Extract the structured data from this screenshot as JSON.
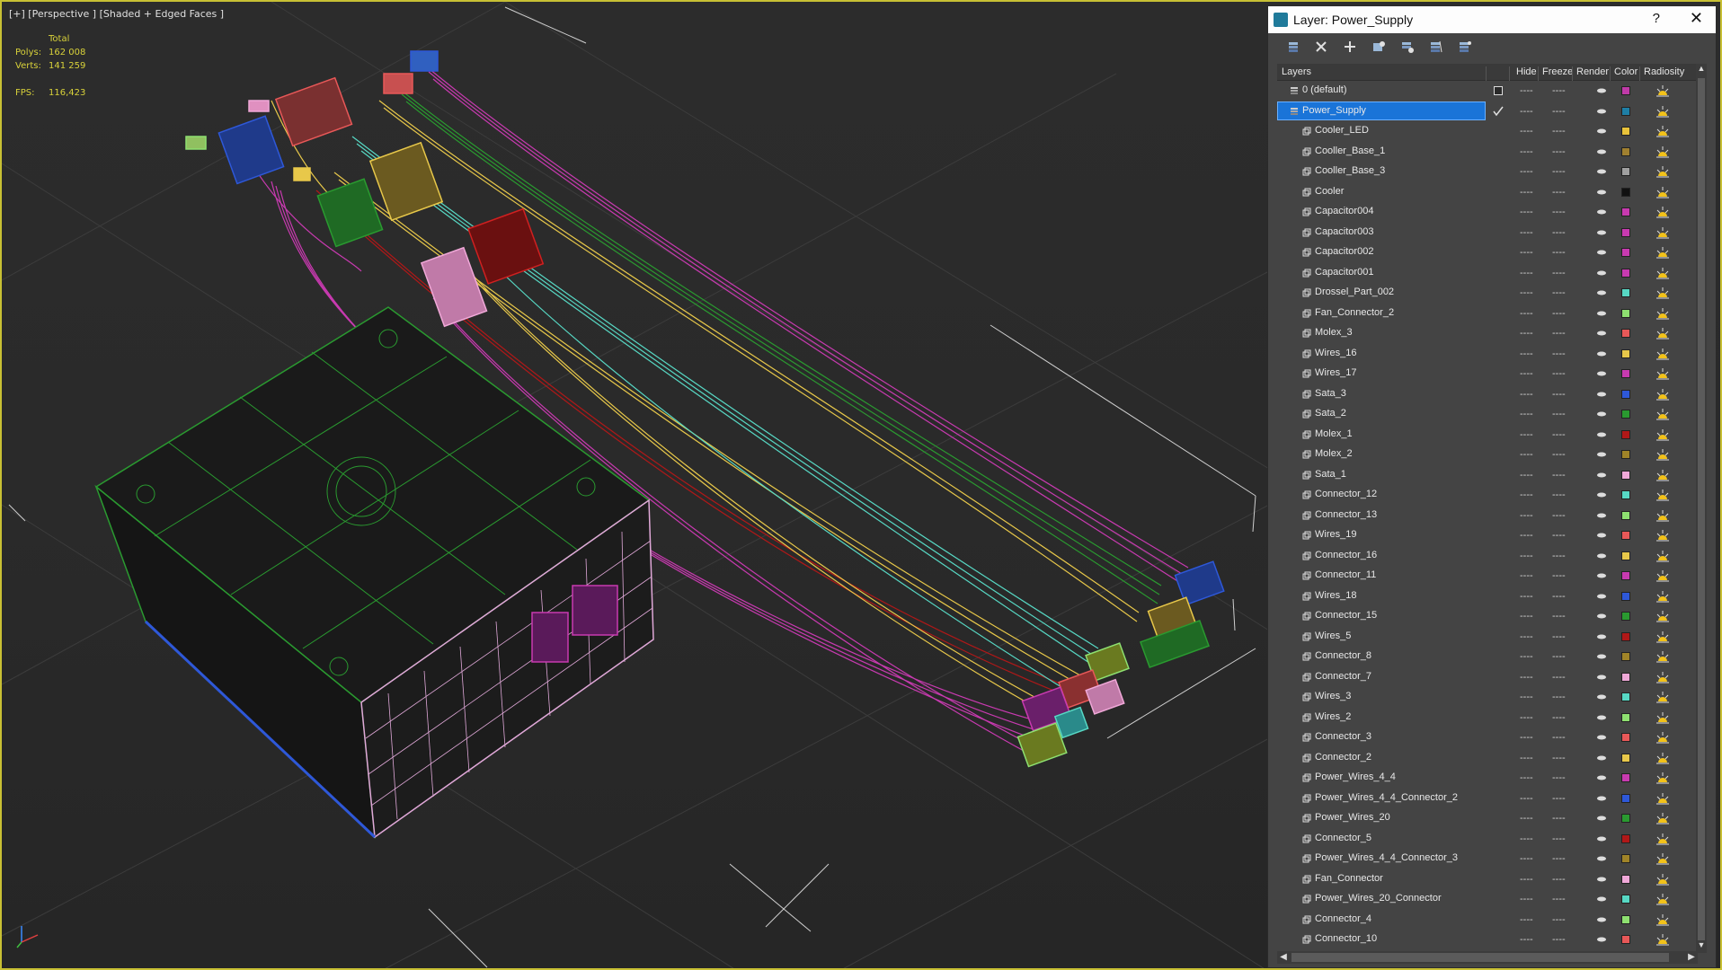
{
  "viewport": {
    "label": "[+] [Perspective ] [Shaded + Edged Faces ]",
    "stats": {
      "total_label": "Total",
      "polys_label": "Polys:",
      "polys_value": "162 008",
      "verts_label": "Verts:",
      "verts_value": "141 259",
      "fps_label": "FPS:",
      "fps_value": "116,423"
    }
  },
  "panel": {
    "title": "Layer: Power_Supply",
    "help": "?",
    "close": "✕",
    "columns": {
      "layers": "Layers",
      "hide": "Hide",
      "freeze": "Freeze",
      "render": "Render",
      "color": "Color",
      "radiosity": "Radiosity"
    },
    "layers": [
      {
        "name": "0 (default)",
        "level": 0,
        "color": "#c03aa8",
        "kind": "layer",
        "checkbox": true
      },
      {
        "name": "Power_Supply",
        "level": 0,
        "color": "#1e7fa6",
        "kind": "layer",
        "selected": true,
        "active": true
      },
      {
        "name": "Cooler_LED",
        "level": 1,
        "color": "#e8c23a"
      },
      {
        "name": "Cooller_Base_1",
        "level": 1,
        "color": "#a08030"
      },
      {
        "name": "Cooller_Base_3",
        "level": 1,
        "color": "#a0a0a0"
      },
      {
        "name": "Cooler",
        "level": 1,
        "color": "#111111"
      },
      {
        "name": "Capacitor004",
        "level": 1,
        "color": "#c83ab0"
      },
      {
        "name": "Capacitor003",
        "level": 1,
        "color": "#c83ab0"
      },
      {
        "name": "Capacitor002",
        "level": 1,
        "color": "#c83ab0"
      },
      {
        "name": "Capacitor001",
        "level": 1,
        "color": "#c83ab0"
      },
      {
        "name": "Drossel_Part_002",
        "level": 1,
        "color": "#57d8c4"
      },
      {
        "name": "Fan_Connector_2",
        "level": 1,
        "color": "#8ee070"
      },
      {
        "name": "Molex_3",
        "level": 1,
        "color": "#e85858"
      },
      {
        "name": "Wires_16",
        "level": 1,
        "color": "#e8c84a"
      },
      {
        "name": "Wires_17",
        "level": 1,
        "color": "#c83ab0"
      },
      {
        "name": "Sata_3",
        "level": 1,
        "color": "#2e58d8"
      },
      {
        "name": "Sata_2",
        "level": 1,
        "color": "#2a9a30"
      },
      {
        "name": "Molex_1",
        "level": 1,
        "color": "#b01818"
      },
      {
        "name": "Molex_2",
        "level": 1,
        "color": "#a08428"
      },
      {
        "name": "Sata_1",
        "level": 1,
        "color": "#f0a8d8"
      },
      {
        "name": "Connector_12",
        "level": 1,
        "color": "#57d8c4"
      },
      {
        "name": "Connector_13",
        "level": 1,
        "color": "#8ee070"
      },
      {
        "name": "Wires_19",
        "level": 1,
        "color": "#e85858"
      },
      {
        "name": "Connector_16",
        "level": 1,
        "color": "#e8c84a"
      },
      {
        "name": "Connector_11",
        "level": 1,
        "color": "#c83ab0"
      },
      {
        "name": "Wires_18",
        "level": 1,
        "color": "#2e58d8"
      },
      {
        "name": "Connector_15",
        "level": 1,
        "color": "#2a9a30"
      },
      {
        "name": "Wires_5",
        "level": 1,
        "color": "#b01818"
      },
      {
        "name": "Connector_8",
        "level": 1,
        "color": "#a08428"
      },
      {
        "name": "Connector_7",
        "level": 1,
        "color": "#f0a8d8"
      },
      {
        "name": "Wires_3",
        "level": 1,
        "color": "#57d8c4"
      },
      {
        "name": "Wires_2",
        "level": 1,
        "color": "#8ee070"
      },
      {
        "name": "Connector_3",
        "level": 1,
        "color": "#e85858"
      },
      {
        "name": "Connector_2",
        "level": 1,
        "color": "#e8c84a"
      },
      {
        "name": "Power_Wires_4_4",
        "level": 1,
        "color": "#c83ab0"
      },
      {
        "name": "Power_Wires_4_4_Connector_2",
        "level": 1,
        "color": "#2e58d8"
      },
      {
        "name": "Power_Wires_20",
        "level": 1,
        "color": "#2a9a30"
      },
      {
        "name": "Connector_5",
        "level": 1,
        "color": "#b01818"
      },
      {
        "name": "Power_Wires_4_4_Connector_3",
        "level": 1,
        "color": "#a08428"
      },
      {
        "name": "Fan_Connector",
        "level": 1,
        "color": "#f0a8d8"
      },
      {
        "name": "Power_Wires_20_Connector",
        "level": 1,
        "color": "#57d8c4"
      },
      {
        "name": "Connector_4",
        "level": 1,
        "color": "#8ee070"
      },
      {
        "name": "Connector_10",
        "level": 1,
        "color": "#e85858"
      }
    ]
  }
}
